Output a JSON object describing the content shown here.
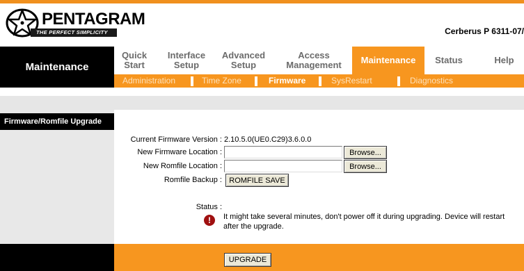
{
  "brand": {
    "name": "PENTAGRAM",
    "slogan": "THE PERFECT SIMPLICITY",
    "model": "Cerberus P 6311-07/"
  },
  "section": {
    "title": "Maintenance"
  },
  "menu": [
    {
      "label": "Quick\nStart",
      "active": false
    },
    {
      "label": "Interface\nSetup",
      "active": false
    },
    {
      "label": "Advanced\nSetup",
      "active": false
    },
    {
      "label": "Access\nManagement",
      "active": false
    },
    {
      "label": "Maintenance",
      "active": true
    },
    {
      "label": "Status",
      "active": false
    },
    {
      "label": "Help",
      "active": false
    }
  ],
  "submenu": [
    {
      "label": "Administration",
      "active": false
    },
    {
      "label": "Time Zone",
      "active": false
    },
    {
      "label": "Firmware",
      "active": true
    },
    {
      "label": "SysRestart",
      "active": false
    },
    {
      "label": "Diagnostics",
      "active": false
    }
  ],
  "page": {
    "side_title": "Firmware/Romfile Upgrade",
    "current_fw_label": "Current Firmware Version :",
    "current_fw_value": "2.10.5.0(UE0.C29)3.6.0.0",
    "new_fw_label": "New Firmware Location :",
    "new_fw_value": "",
    "new_rom_label": "New Romfile Location :",
    "new_rom_value": "",
    "browse_label": "Browse...",
    "rom_backup_label": "Romfile Backup :",
    "romfile_save_label": "ROMFILE SAVE",
    "status_label": "Status :",
    "status_message": "It might take several minutes, don't power off it during upgrading. Device will restart after the upgrade.",
    "upgrade_label": "UPGRADE"
  },
  "colors": {
    "accent": "#f7961f",
    "dark": "#000000",
    "warning": "#a01010"
  },
  "icons": {
    "logo": "pentagram-star-logo",
    "warning": "warning-icon"
  }
}
